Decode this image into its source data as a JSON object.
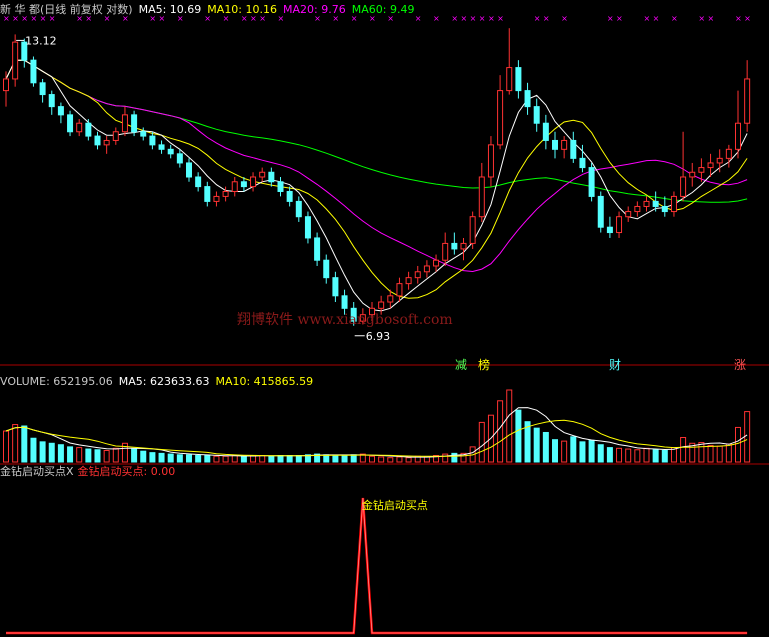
{
  "price_panel": {
    "stock_label": "新 华 都(日线 前复权 对数)",
    "ma5_label": "MA5: 10.69",
    "ma10_label": "MA10: 10.16",
    "ma20_label": "MA20: 9.76",
    "ma60_label": "MA60: 9.49",
    "high_label": "13.12",
    "low_label": "6.93",
    "badges": [
      "减",
      "榜",
      "财",
      "涨"
    ],
    "watermark": "翔博软件 www.xiangbosoft.com"
  },
  "volume_panel": {
    "volume_label": "VOLUME: 652195.06",
    "ma5_label": "MA5: 623633.63",
    "ma10_label": "MA10: 415865.59"
  },
  "indicator_panel": {
    "name_label": "金钻启动买点X",
    "value_label": "金钻启动买点: 0.00",
    "signal_label": "金钻启动买点"
  },
  "colors": {
    "up": "#ff3232",
    "down": "#54ffff",
    "ma5": "#ffffff",
    "ma10": "#ffff00",
    "ma20": "#ff00ff",
    "ma60": "#00ff00",
    "marker": "#ff00ff",
    "signal": "#ff0000",
    "separator": "#aa0000"
  },
  "chart_data": [
    {
      "type": "candlestick",
      "title": "新 华 都(日线 前复权 对数)",
      "ylim": [
        6.5,
        13.6
      ],
      "log_scale": true,
      "high_marker": 13.12,
      "low_marker": 6.93,
      "candles_ohlc": [
        [
          11.6,
          12.1,
          11.2,
          11.9
        ],
        [
          11.9,
          13.12,
          11.7,
          12.9
        ],
        [
          12.9,
          13.0,
          12.2,
          12.4
        ],
        [
          12.4,
          12.5,
          11.7,
          11.8
        ],
        [
          11.8,
          11.9,
          11.3,
          11.5
        ],
        [
          11.5,
          11.6,
          11.0,
          11.2
        ],
        [
          11.2,
          11.3,
          10.8,
          11.0
        ],
        [
          11.0,
          11.1,
          10.5,
          10.6
        ],
        [
          10.6,
          10.9,
          10.5,
          10.8
        ],
        [
          10.8,
          10.9,
          10.4,
          10.5
        ],
        [
          10.5,
          10.6,
          10.2,
          10.3
        ],
        [
          10.3,
          10.5,
          10.1,
          10.4
        ],
        [
          10.4,
          10.7,
          10.3,
          10.6
        ],
        [
          10.6,
          11.2,
          10.5,
          11.0
        ],
        [
          11.0,
          11.1,
          10.5,
          10.6
        ],
        [
          10.6,
          10.7,
          10.4,
          10.5
        ],
        [
          10.5,
          10.6,
          10.2,
          10.3
        ],
        [
          10.3,
          10.4,
          10.1,
          10.2
        ],
        [
          10.2,
          10.3,
          10.0,
          10.1
        ],
        [
          10.1,
          10.2,
          9.8,
          9.9
        ],
        [
          9.9,
          10.0,
          9.5,
          9.6
        ],
        [
          9.6,
          9.7,
          9.3,
          9.4
        ],
        [
          9.4,
          9.5,
          9.0,
          9.1
        ],
        [
          9.1,
          9.3,
          9.0,
          9.2
        ],
        [
          9.2,
          9.4,
          9.1,
          9.3
        ],
        [
          9.3,
          9.6,
          9.2,
          9.5
        ],
        [
          9.5,
          9.6,
          9.3,
          9.4
        ],
        [
          9.4,
          9.7,
          9.3,
          9.6
        ],
        [
          9.6,
          9.8,
          9.5,
          9.7
        ],
        [
          9.7,
          9.8,
          9.4,
          9.5
        ],
        [
          9.5,
          9.6,
          9.2,
          9.3
        ],
        [
          9.3,
          9.4,
          9.0,
          9.1
        ],
        [
          9.1,
          9.2,
          8.7,
          8.8
        ],
        [
          8.8,
          8.9,
          8.3,
          8.4
        ],
        [
          8.4,
          8.5,
          7.9,
          8.0
        ],
        [
          8.0,
          8.1,
          7.6,
          7.7
        ],
        [
          7.7,
          7.8,
          7.3,
          7.4
        ],
        [
          7.4,
          7.5,
          7.1,
          7.2
        ],
        [
          7.2,
          7.3,
          6.93,
          7.0
        ],
        [
          7.0,
          7.2,
          6.95,
          7.1
        ],
        [
          7.1,
          7.3,
          7.0,
          7.2
        ],
        [
          7.2,
          7.4,
          7.1,
          7.3
        ],
        [
          7.3,
          7.5,
          7.2,
          7.4
        ],
        [
          7.4,
          7.7,
          7.3,
          7.6
        ],
        [
          7.6,
          7.8,
          7.5,
          7.7
        ],
        [
          7.7,
          7.9,
          7.6,
          7.8
        ],
        [
          7.8,
          8.0,
          7.7,
          7.9
        ],
        [
          7.9,
          8.1,
          7.8,
          8.0
        ],
        [
          8.0,
          8.5,
          7.9,
          8.3
        ],
        [
          8.3,
          8.5,
          8.1,
          8.2
        ],
        [
          8.2,
          8.4,
          8.0,
          8.3
        ],
        [
          8.3,
          8.9,
          8.2,
          8.8
        ],
        [
          8.8,
          9.9,
          8.7,
          9.6
        ],
        [
          9.6,
          10.5,
          9.4,
          10.3
        ],
        [
          10.3,
          12.0,
          10.2,
          11.6
        ],
        [
          11.6,
          13.3,
          11.5,
          12.2
        ],
        [
          12.2,
          12.4,
          11.4,
          11.6
        ],
        [
          11.6,
          11.8,
          11.0,
          11.2
        ],
        [
          11.2,
          11.4,
          10.6,
          10.8
        ],
        [
          10.8,
          11.0,
          10.2,
          10.4
        ],
        [
          10.4,
          10.6,
          10.0,
          10.2
        ],
        [
          10.2,
          10.5,
          10.0,
          10.4
        ],
        [
          10.4,
          10.6,
          9.9,
          10.0
        ],
        [
          10.0,
          10.3,
          9.7,
          9.8
        ],
        [
          9.8,
          9.9,
          9.1,
          9.2
        ],
        [
          9.2,
          9.3,
          8.5,
          8.6
        ],
        [
          8.6,
          8.8,
          8.4,
          8.5
        ],
        [
          8.5,
          8.9,
          8.4,
          8.8
        ],
        [
          8.8,
          9.0,
          8.7,
          8.9
        ],
        [
          8.9,
          9.1,
          8.8,
          9.0
        ],
        [
          9.0,
          9.2,
          8.9,
          9.1
        ],
        [
          9.1,
          9.3,
          8.9,
          9.0
        ],
        [
          9.0,
          9.2,
          8.8,
          8.9
        ],
        [
          8.9,
          9.3,
          8.8,
          9.2
        ],
        [
          9.2,
          10.6,
          9.1,
          9.6
        ],
        [
          9.6,
          9.9,
          9.4,
          9.7
        ],
        [
          9.7,
          10.0,
          9.5,
          9.8
        ],
        [
          9.8,
          10.1,
          9.6,
          9.9
        ],
        [
          9.9,
          10.2,
          9.7,
          10.0
        ],
        [
          10.0,
          10.3,
          9.8,
          10.2
        ],
        [
          10.2,
          11.6,
          10.0,
          10.8
        ],
        [
          10.8,
          12.4,
          10.6,
          11.9
        ]
      ]
    },
    {
      "type": "bar",
      "title": "VOLUME",
      "ylim": [
        0,
        1000000
      ],
      "values": [
        430000,
        520000,
        500000,
        330000,
        280000,
        260000,
        240000,
        210000,
        200000,
        180000,
        170000,
        160000,
        190000,
        260000,
        180000,
        150000,
        130000,
        120000,
        110000,
        100000,
        100000,
        90000,
        90000,
        80000,
        80000,
        90000,
        80000,
        90000,
        90000,
        80000,
        90000,
        90000,
        90000,
        100000,
        110000,
        100000,
        90000,
        90000,
        100000,
        110000,
        80000,
        70000,
        60000,
        70000,
        60000,
        80000,
        70000,
        90000,
        110000,
        120000,
        120000,
        210000,
        550000,
        650000,
        850000,
        1000000,
        720000,
        560000,
        470000,
        410000,
        310000,
        290000,
        350000,
        280000,
        300000,
        240000,
        200000,
        190000,
        180000,
        170000,
        190000,
        170000,
        160000,
        200000,
        340000,
        260000,
        270000,
        230000,
        220000,
        250000,
        480000,
        700000
      ]
    },
    {
      "type": "line",
      "title": "金钻启动买点",
      "ylim": [
        0,
        1
      ],
      "signal_index": 39,
      "values": [
        0,
        0,
        0,
        0,
        0,
        0,
        0,
        0,
        0,
        0,
        0,
        0,
        0,
        0,
        0,
        0,
        0,
        0,
        0,
        0,
        0,
        0,
        0,
        0,
        0,
        0,
        0,
        0,
        0,
        0,
        0,
        0,
        0,
        0,
        0,
        0,
        0,
        0,
        0,
        1,
        0,
        0,
        0,
        0,
        0,
        0,
        0,
        0,
        0,
        0,
        0,
        0,
        0,
        0,
        0,
        0,
        0,
        0,
        0,
        0,
        0,
        0,
        0,
        0,
        0,
        0,
        0,
        0,
        0,
        0,
        0,
        0,
        0,
        0,
        0,
        0,
        0,
        0,
        0,
        0,
        0,
        0
      ]
    }
  ]
}
